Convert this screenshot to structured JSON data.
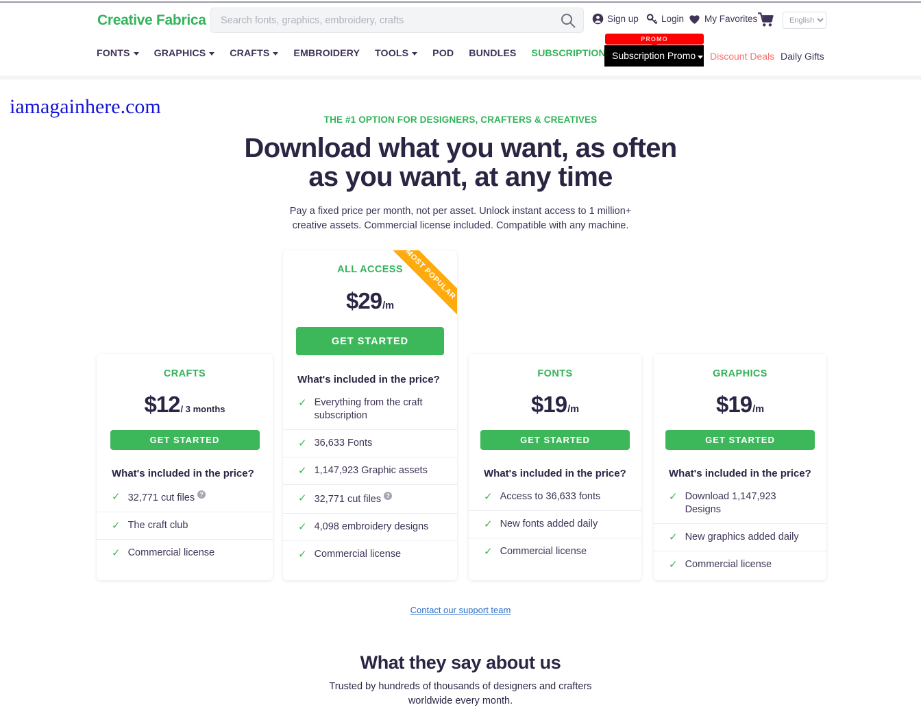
{
  "header": {
    "brand": "Creative Fabrica",
    "search": {
      "placeholder": "Search fonts, graphics, embroidery, crafts",
      "value": ""
    },
    "utility": [
      {
        "label": "Sign up",
        "icon": "user-circle-icon"
      },
      {
        "label": "Login",
        "icon": "key-icon"
      },
      {
        "label": "My Favorites",
        "icon": "heart-icon"
      }
    ],
    "cart_icon": "shopping-cart-icon",
    "language": "English",
    "nav": [
      {
        "label": "FONTS",
        "caret": true,
        "accent": false
      },
      {
        "label": "GRAPHICS",
        "caret": true,
        "accent": false
      },
      {
        "label": "CRAFTS",
        "caret": true,
        "accent": false
      },
      {
        "label": "EMBROIDERY",
        "caret": false,
        "accent": false
      },
      {
        "label": "TOOLS",
        "caret": true,
        "accent": false
      },
      {
        "label": "POD",
        "caret": false,
        "accent": false
      },
      {
        "label": "BUNDLES",
        "caret": false,
        "accent": false
      },
      {
        "label": "SUBSCRIPTION",
        "caret": false,
        "accent": true
      }
    ],
    "promo": {
      "badge": "PROMO",
      "button": "Subscription Promo",
      "discount_deals": "Discount Deals",
      "daily_gifts": "Daily Gifts"
    }
  },
  "watermark": "iamagainhere.com",
  "hero": {
    "eyebrow": "THE #1 OPTION FOR DESIGNERS, CRAFTERS & CREATIVES",
    "title_line1": "Download what you want, as often",
    "title_line2": "as you want, at any time",
    "subtitle_line1": "Pay a fixed price per month, not per asset. Unlock instant access to 1 million+",
    "subtitle_line2": "creative assets. Commercial license included. Compatible with any machine."
  },
  "pricing": {
    "included_heading": "What's included in the price?",
    "cta_label": "GET STARTED",
    "ribbon": "MOST POPULAR",
    "crafts": {
      "title": "CRAFTS",
      "price": "$12",
      "period": "/ 3 months",
      "features": [
        {
          "text": "32,771 cut files",
          "help": true
        },
        {
          "text": "The craft club",
          "help": false
        },
        {
          "text": "Commercial license",
          "help": false
        }
      ]
    },
    "all_access": {
      "title": "ALL ACCESS",
      "price": "$29",
      "period": "/m",
      "features": [
        {
          "text": "Everything from the craft subscription",
          "help": false
        },
        {
          "text": "36,633 Fonts",
          "help": false
        },
        {
          "text": "1,147,923 Graphic assets",
          "help": false
        },
        {
          "text": "32,771 cut files",
          "help": true
        },
        {
          "text": "4,098 embroidery designs",
          "help": false
        },
        {
          "text": "Commercial license",
          "help": false
        }
      ]
    },
    "fonts": {
      "title": "FONTS",
      "price": "$19",
      "period": "/m",
      "features": [
        {
          "text": "Access to 36,633 fonts",
          "help": false
        },
        {
          "text": "New fonts added daily",
          "help": false
        },
        {
          "text": "Commercial license",
          "help": false
        }
      ]
    },
    "graphics": {
      "title": "GRAPHICS",
      "price": "$19",
      "period": "/m",
      "features": [
        {
          "text": "Download 1,147,923 Designs",
          "help": false
        },
        {
          "text": "New graphics added daily",
          "help": false
        },
        {
          "text": "Commercial license",
          "help": false
        }
      ]
    }
  },
  "footer": {
    "support_link": "Contact our support team",
    "testimonials_title": "What they say about us",
    "testimonials_sub_line1": "Trusted by hundreds of thousands of designers and crafters",
    "testimonials_sub_line2": "worldwide every month."
  },
  "colors": {
    "brand_green": "#33b35a",
    "cta_green": "#3cb75a",
    "dark_navy": "#2b2544",
    "ribbon_orange": "#ffab0e",
    "promo_red": "#ff0000",
    "link_blue": "#2a6fc9",
    "watermark_blue": "#1414d8"
  }
}
